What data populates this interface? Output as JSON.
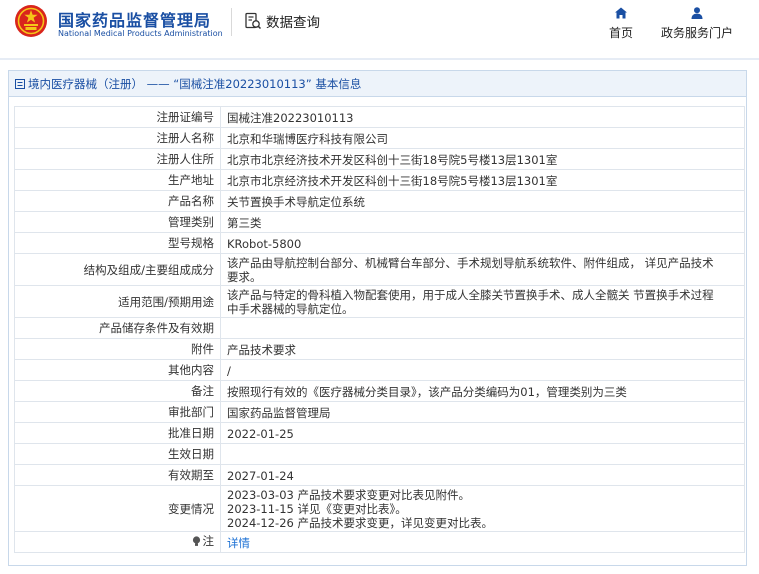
{
  "header": {
    "brand_cn": "国家药品监督管理局",
    "brand_en": "National Medical Products Administration",
    "query_label": "数据查询",
    "nav": [
      {
        "label": "首页",
        "icon": "home-icon"
      },
      {
        "label": "政务服务门户",
        "icon": "user-icon"
      }
    ],
    "brand_color": "#1a4fa3",
    "emblem_color": "#d9251c"
  },
  "panel": {
    "title": "境内医疗器械（注册） —— “国械注准20223010113” 基本信息"
  },
  "rows": [
    {
      "label": "注册证编号",
      "value": "国械注准20223010113"
    },
    {
      "label": "注册人名称",
      "value": "北京和华瑞博医疗科技有限公司"
    },
    {
      "label": "注册人住所",
      "value": "北京市北京经济技术开发区科创十三街18号院5号楼13层1301室"
    },
    {
      "label": "生产地址",
      "value": "北京市北京经济技术开发区科创十三街18号院5号楼13层1301室"
    },
    {
      "label": "产品名称",
      "value": "关节置换手术导航定位系统"
    },
    {
      "label": "管理类别",
      "value": "第三类"
    },
    {
      "label": "型号规格",
      "value": "KRobot-5800"
    },
    {
      "label": "结构及组成/主要组成成分",
      "value_lines": [
        "该产品由导航控制台部分、机械臂台车部分、手术规划导航系统软件、附件组成， 详见产品技术",
        "要求。"
      ]
    },
    {
      "label": "适用范围/预期用途",
      "value_lines": [
        "该产品与特定的骨科植入物配套使用，用于成人全膝关节置换手术、成人全髋关 节置换手术过程",
        "中手术器械的导航定位。"
      ]
    },
    {
      "label": "产品储存条件及有效期",
      "value": ""
    },
    {
      "label": "附件",
      "value": "产品技术要求"
    },
    {
      "label": "其他内容",
      "value": "/"
    },
    {
      "label": "备注",
      "value": "按照现行有效的《医疗器械分类目录》，该产品分类编码为01，管理类别为三类"
    },
    {
      "label": "审批部门",
      "value": "国家药品监督管理局"
    },
    {
      "label": "批准日期",
      "value": "2022-01-25"
    },
    {
      "label": "生效日期",
      "value": ""
    },
    {
      "label": "有效期至",
      "value": "2027-01-24"
    },
    {
      "label": "变更情况",
      "value_lines": [
        "2023-03-03 产品技术要求变更对比表见附件。",
        "2023-11-15 详见《变更对比表》。",
        "2024-12-26 产品技术要求变更，详见变更对比表。"
      ]
    },
    {
      "label": "注",
      "value": "详情",
      "icon": "lightbulb-icon"
    }
  ]
}
